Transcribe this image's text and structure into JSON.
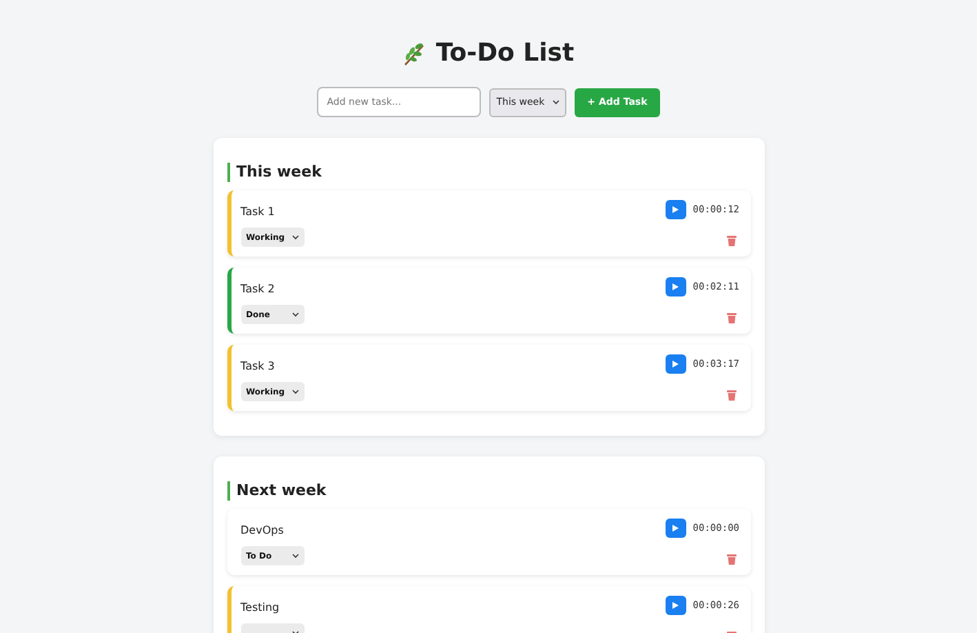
{
  "title": "To-Do List",
  "new_task": {
    "placeholder": "Add new task...",
    "week": "This week",
    "add_button": "+ Add Task"
  },
  "groups": [
    {
      "title": "This week",
      "tasks": [
        {
          "name": "Task 1",
          "kind": "working",
          "status": "Working",
          "time": "00:00:12"
        },
        {
          "name": "Task 2",
          "kind": "done",
          "status": "Done",
          "time": "00:02:11"
        },
        {
          "name": "Task 3",
          "kind": "working",
          "status": "Working",
          "time": "00:03:17"
        }
      ]
    },
    {
      "title": "Next week",
      "tasks": [
        {
          "name": "DevOps",
          "kind": "todo",
          "status": "To Do",
          "time": "00:00:00"
        },
        {
          "name": "Testing",
          "kind": "working",
          "time": "00:00:26"
        }
      ]
    }
  ]
}
